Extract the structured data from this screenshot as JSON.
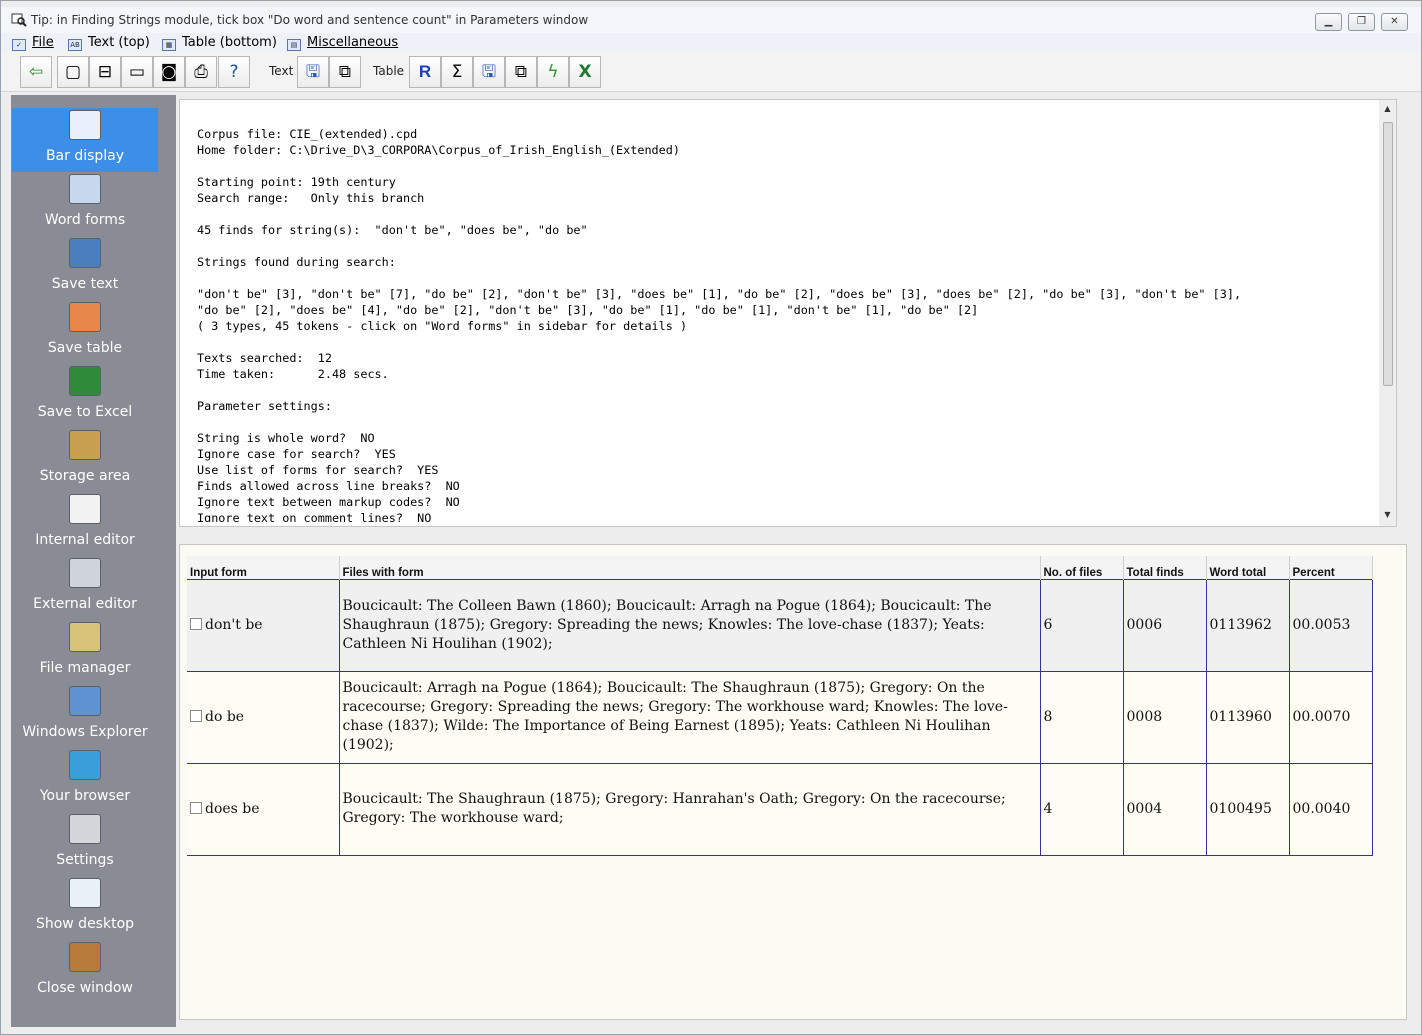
{
  "window": {
    "title": "Tip: in Finding Strings module, tick box \"Do word and sentence count\" in Parameters window"
  },
  "menu": [
    {
      "label": "File",
      "icon": "check-icon"
    },
    {
      "label": "Text (top)",
      "icon": "text-icon"
    },
    {
      "label": "Table (bottom)",
      "icon": "table-icon"
    },
    {
      "label": "Miscellaneous",
      "icon": "misc-icon"
    }
  ],
  "toolbar": {
    "text_label": "Text",
    "table_label": "Table",
    "r_glyph": "R",
    "sigma_glyph": "Σ"
  },
  "sidebar": [
    {
      "label": "Bar display",
      "icon": "bar-display-icon",
      "color": "#e8f1fb"
    },
    {
      "label": "Word forms",
      "icon": "word-forms-icon",
      "color": "#c6d8ee"
    },
    {
      "label": "Save text",
      "icon": "save-text-icon",
      "color": "#4a7fbf"
    },
    {
      "label": "Save table",
      "icon": "save-table-icon",
      "color": "#e8874a"
    },
    {
      "label": "Save to Excel",
      "icon": "excel-icon",
      "color": "#2f8a3a"
    },
    {
      "label": "Storage area",
      "icon": "clipboard-icon",
      "color": "#c8a050"
    },
    {
      "label": "Internal editor",
      "icon": "notepad-icon",
      "color": "#f2f2f2"
    },
    {
      "label": "External editor",
      "icon": "wrench-icon",
      "color": "#cfd3da"
    },
    {
      "label": "File manager",
      "icon": "file-manager-icon",
      "color": "#d8c27a"
    },
    {
      "label": "Windows Explorer",
      "icon": "computer-icon",
      "color": "#5e92d1"
    },
    {
      "label": "Your browser",
      "icon": "globe-icon",
      "color": "#3a9ed8"
    },
    {
      "label": "Settings",
      "icon": "gear-icon",
      "color": "#d4d6db"
    },
    {
      "label": "Show desktop",
      "icon": "desktop-icon",
      "color": "#eaf0f8"
    },
    {
      "label": "Close window",
      "icon": "door-exit-icon",
      "color": "#b87a3a"
    }
  ],
  "report": [
    "Corpus file: CIE_(extended).cpd",
    "Home folder: C:\\Drive_D\\3_CORPORA\\Corpus_of_Irish_English_(Extended)",
    "",
    "Starting point: 19th century",
    "Search range:   Only this branch",
    "",
    "45 finds for string(s):  \"don't be\", \"does be\", \"do be\"",
    "",
    "Strings found during search:",
    "",
    "\"don't be\" [3], \"don't be\" [7], \"do be\" [2], \"don't be\" [3], \"does be\" [1], \"do be\" [2], \"does be\" [3], \"does be\" [2], \"do be\" [3], \"don't be\" [3],",
    "\"do be\" [2], \"does be\" [4], \"do be\" [2], \"don't be\" [3], \"do be\" [1], \"do be\" [1], \"don't be\" [1], \"do be\" [2]",
    "( 3 types, 45 tokens - click on \"Word forms\" in sidebar for details )",
    "",
    "Texts searched:  12",
    "Time taken:      2.48 secs.",
    "",
    "Parameter settings:",
    "",
    "String is whole word?  NO",
    "Ignore case for search?  YES",
    "Use list of forms for search?  YES",
    "Finds allowed across line breaks?  NO",
    "Ignore text between markup codes?  NO",
    "Ignore text on comment lines?  NO"
  ],
  "table": {
    "headers": [
      "Input form",
      "Files with form",
      "No. of files",
      "Total finds",
      "Word total",
      "Percent"
    ],
    "rows": [
      {
        "form": "don't be",
        "files": "Boucicault: The Colleen Bawn (1860); Boucicault: Arragh na Pogue (1864); Boucicault: The Shaughraun (1875); Gregory: Spreading the news; Knowles: The love-chase (1837); Yeats: Cathleen Ni Houlihan (1902);",
        "nfiles": "6",
        "finds": "0006",
        "words": "0113962",
        "percent": "00.0053"
      },
      {
        "form": "do be",
        "files": "Boucicault: Arragh na Pogue (1864); Boucicault: The Shaughraun (1875); Gregory: On the racecourse; Gregory: Spreading the news; Gregory: The workhouse ward; Knowles: The love-chase (1837); Wilde: The Importance of Being Earnest (1895); Yeats: Cathleen Ni Houlihan (1902);",
        "nfiles": "8",
        "finds": "0008",
        "words": "0113960",
        "percent": "00.0070"
      },
      {
        "form": "does be",
        "files": "Boucicault: The Shaughraun (1875); Gregory: Hanrahan's Oath; Gregory: On the racecourse; Gregory: The workhouse ward;",
        "nfiles": "4",
        "finds": "0004",
        "words": "0100495",
        "percent": "00.0040"
      }
    ]
  }
}
